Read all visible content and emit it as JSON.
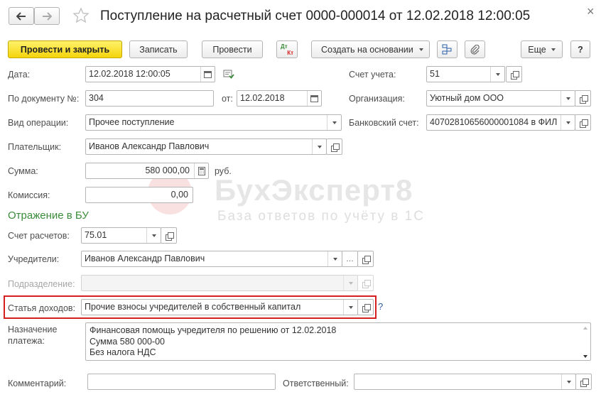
{
  "window": {
    "title": "Поступление на расчетный счет 0000-000014 от 12.02.2018 12:00:05",
    "close_glyph": "×"
  },
  "toolbar": {
    "post_close": "Провести и закрыть",
    "save": "Записать",
    "post": "Провести",
    "dtkt_top": "Дт",
    "dtkt_bottom": "Кт",
    "create_based": "Создать на основании",
    "more": "Еще",
    "help": "?"
  },
  "form": {
    "date_label": "Дата:",
    "date_value": "12.02.2018 12:00:05",
    "doc_no_label": "По документу №:",
    "doc_no_value": "304",
    "from_label": "от:",
    "from_value": "12.02.2018",
    "op_type_label": "Вид операции:",
    "op_type_value": "Прочее поступление",
    "payer_label": "Плательщик:",
    "payer_value": "Иванов Александр Павлович",
    "sum_label": "Сумма:",
    "sum_value": "580 000,00",
    "currency": "руб.",
    "commission_label": "Комиссия:",
    "commission_value": "0,00",
    "account_label": "Счет учета:",
    "account_value": "51",
    "org_label": "Организация:",
    "org_value": "Уютный дом ООО",
    "bank_label": "Банковский счет:",
    "bank_value": "40702810656000001084 в ФИЛ"
  },
  "section": {
    "title": "Отражение в БУ",
    "settle_label": "Счет расчетов:",
    "settle_value": "75.01",
    "founders_label": "Учредители:",
    "founders_value": "Иванов Александр Павлович",
    "subdiv_label": "Подразделение:",
    "income_label": "Статья доходов:",
    "income_value": "Прочие взносы учредителей в собственный капитал",
    "help_q": "?"
  },
  "purpose": {
    "label_1": "Назначение",
    "label_2": "платежа:",
    "line_1": "Финансовая помощь учредителя по решению от 12.02.2018",
    "line_2": "Сумма 580 000-00",
    "line_3": "Без налога НДС"
  },
  "footer": {
    "comment_label": "Комментарий:",
    "responsible_label": "Ответственный:"
  },
  "watermark": {
    "brand": "БухЭксперт8",
    "tagline": "База ответов по учёту в 1С"
  },
  "colors": {
    "accent_green": "#3a8b3a",
    "primary_yellow": "#f5d40b",
    "highlight_red": "#d62020"
  }
}
